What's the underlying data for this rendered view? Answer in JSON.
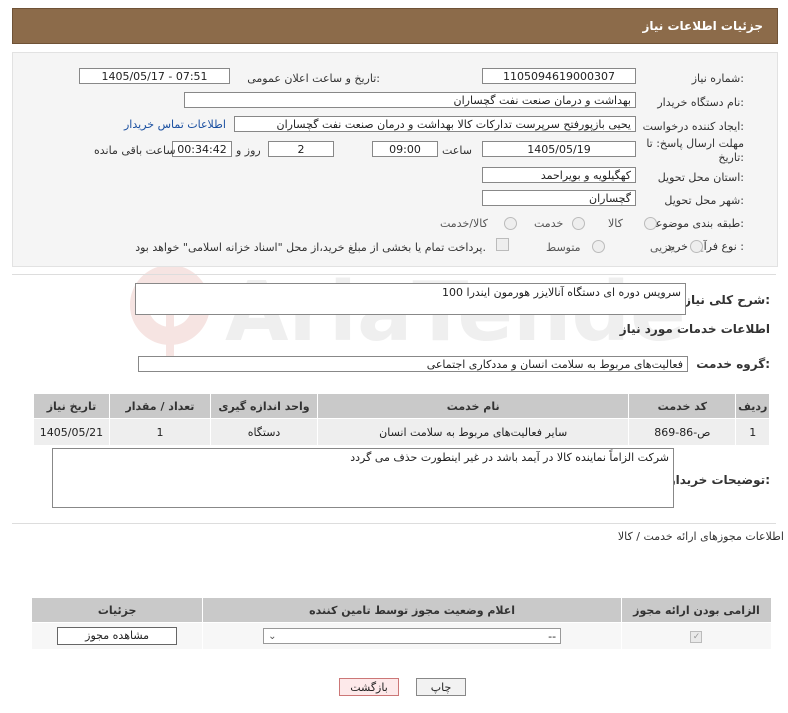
{
  "header": {
    "title": "جزئیات اطلاعات نیاز"
  },
  "fields": {
    "need_number_label": "شماره نیاز:",
    "need_number": "1105094619000307",
    "announce_label": "تاریخ و ساعت اعلان عمومی:",
    "announce_value": "1405/05/17 - 07:51",
    "buyer_label": "نام دستگاه خریدار:",
    "buyer": "بهداشت و درمان صنعت نفت گچساران",
    "creator_label": "ایجاد کننده درخواست:",
    "creator": "یحیی بازپورفتح سرپرست تدارکات کالا  بهداشت و درمان صنعت نفت گچساران",
    "contact_link": "اطلاعات تماس خریدار",
    "deadline_label": "مهلت ارسال پاسخ: تا تاریخ:",
    "deadline_date": "1405/05/19",
    "time_label": "ساعت",
    "deadline_time": "09:00",
    "days": "2",
    "days_label": "روز و",
    "remaining": "00:34:42",
    "remaining_label": "ساعت باقی مانده",
    "province_label": "استان محل تحویل:",
    "province": "کهگیلویه و بویراحمد",
    "city_label": "شهر محل تحویل:",
    "city": "گچساران",
    "category_label": "طبقه بندی موضوعی:",
    "category_options": [
      "کالا",
      "خدمت",
      "کالا/خدمت"
    ],
    "process_label": "نوع فرآیند خرید :",
    "process_options": [
      "جزیی",
      "متوسط"
    ],
    "payment_note": "پرداخت تمام یا بخشی از مبلغ خرید،از محل \"اسناد خزانه اسلامی\" خواهد بود."
  },
  "summary": {
    "label": "شرح کلی نیاز:",
    "value": "سرویس دوره ای دستگاه آنالایزر هورمون ایندرا 100"
  },
  "services_title": "اطلاعات خدمات مورد نیاز",
  "service_group": {
    "label": "گروه خدمت:",
    "value": "فعالیت‌های مربوط به سلامت انسان و مددکاری اجتماعی"
  },
  "table": {
    "headers": [
      "ردیف",
      "کد خدمت",
      "نام خدمت",
      "واحد اندازه گیری",
      "تعداد / مقدار",
      "تاریخ نیاز"
    ],
    "rows": [
      [
        "1",
        "ص-86-869",
        "سایر فعالیت‌های مربوط به سلامت انسان",
        "دستگاه",
        "1",
        "1405/05/21"
      ]
    ]
  },
  "buyer_notes": {
    "label": "توضیحات خریدار:",
    "value": "شرکت الزاماً نماینده کالا در آیمد باشد در غیر اینطورت حذف می گردد"
  },
  "permits": {
    "title": "اطلاعات مجوزهای ارائه خدمت / کالا",
    "headers": [
      "الزامی بودن ارائه مجوز",
      "اعلام وضعیت مجوز توسط تامین کننده",
      "جزئیات"
    ],
    "select_value": "--",
    "view_button": "مشاهده مجوز"
  },
  "buttons": {
    "print": "چاپ",
    "back": "بازگشت"
  },
  "watermark": "AriaTender.net"
}
